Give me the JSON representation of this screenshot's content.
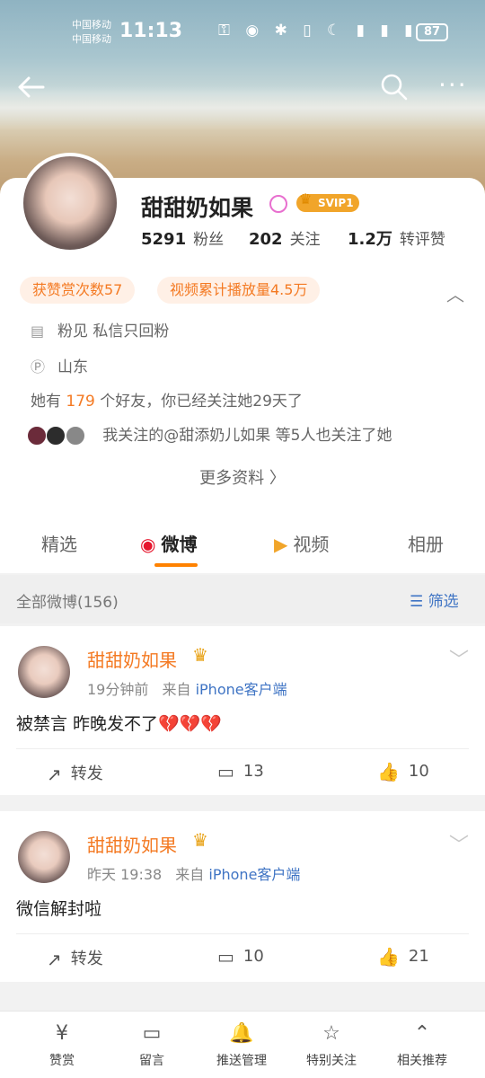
{
  "status_bar": {
    "carrier_line1": "中国移动",
    "carrier_line2": "中国移动",
    "time": "11:13",
    "icons": "⚿ ◉ ✱ ▯ ☾ ▮ ▮ ▮",
    "battery": "87"
  },
  "top_nav": {
    "back_icon": "arrow-left-icon",
    "search_icon": "search-icon",
    "more_icon": "more-dots-icon",
    "more_glyph": "···"
  },
  "profile": {
    "name": "甜甜奶如果",
    "vip_badge": "SVIP1",
    "stats": [
      {
        "value": "5291",
        "label": "粉丝"
      },
      {
        "value": "202",
        "label": "关注"
      },
      {
        "value": "1.2万",
        "label": "转评赞"
      }
    ],
    "tags": [
      "获赞赏次数57",
      "视频累计播放量4.5万"
    ],
    "info": [
      {
        "icon": "document-icon",
        "text": "粉见 私信只回粉"
      },
      {
        "icon": "ip-icon",
        "text": "山东"
      }
    ],
    "friends_prefix": "她有",
    "friends_count": "179",
    "friends_suffix": "个好友，你已经关注她29天了",
    "mutual_follow": "我关注的@甜添奶儿如果 等5人也关注了她",
    "more_info": "更多资料 〉"
  },
  "tabs": [
    {
      "label": "精选",
      "active": false
    },
    {
      "label": "微博",
      "active": true
    },
    {
      "label": "视频",
      "active": false
    },
    {
      "label": "相册",
      "active": false
    }
  ],
  "filter": {
    "count_label": "全部微博(156)",
    "filter_label": "筛选"
  },
  "posts": [
    {
      "name": "甜甜奶如果",
      "time": "19分钟前",
      "from": "来自",
      "source": "iPhone客户端",
      "text": "被禁言 昨晚发不了",
      "emoji": "💔💔💔",
      "repost": "转发",
      "comments": "13",
      "likes": "10"
    },
    {
      "name": "甜甜奶如果",
      "time": "昨天 19:38",
      "from": "来自",
      "source": "iPhone客户端",
      "text": "微信解封啦",
      "emoji": "",
      "repost": "转发",
      "comments": "10",
      "likes": "21"
    }
  ],
  "bottom_bar": [
    {
      "icon": "reward-icon",
      "label": "赞赏"
    },
    {
      "icon": "message-icon",
      "label": "留言"
    },
    {
      "icon": "bell-plus-icon",
      "label": "推送管理"
    },
    {
      "icon": "special-follow-icon",
      "label": "特别关注"
    },
    {
      "icon": "recommend-icon",
      "label": "相关推荐"
    }
  ],
  "colors": {
    "accent_orange": "#f47a23",
    "link_blue": "#3f74c4",
    "tab_underline": "#ff8200"
  }
}
